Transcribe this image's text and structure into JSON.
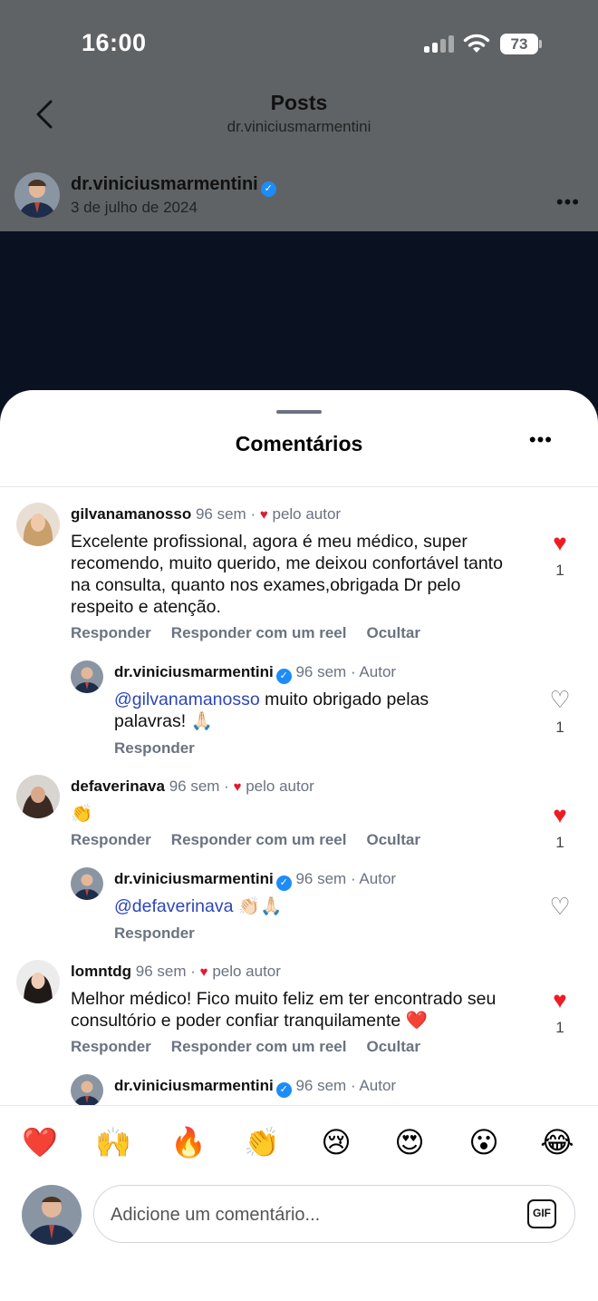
{
  "status_bar": {
    "time": "16:00",
    "battery": "73"
  },
  "header": {
    "title": "Posts",
    "subtitle": "dr.viniciusmarmentini"
  },
  "post": {
    "username": "dr.viniciusmarmentini",
    "date": "3 de julho de 2024",
    "more": "•••"
  },
  "sheet": {
    "title": "Comentários",
    "more": "•••"
  },
  "actions": {
    "reply": "Responder",
    "reply_reel": "Responder com um reel",
    "hide": "Ocultar"
  },
  "comments": [
    {
      "username": "gilvanamanosso",
      "time": "96 sem",
      "sep": "·",
      "badge": "pelo autor",
      "text": "Excelente profissional, agora é meu médico, super recomendo, muito querido, me deixou confortável tanto na consulta, quanto nos exames,obrigada Dr pelo respeito e atenção.",
      "likes": "1",
      "reply": {
        "username": "dr.viniciusmarmentini",
        "time": "96 sem",
        "sep": "·",
        "tag": "Autor",
        "mention": "@gilvanamanosso",
        "text": " muito obrigado pelas palavras! 🙏🏻",
        "likes": "1",
        "reply_label": "Responder"
      }
    },
    {
      "username": "defaverinava",
      "time": "96 sem",
      "sep": "·",
      "badge": "pelo autor",
      "text": "👏",
      "likes": "1",
      "reply": {
        "username": "dr.viniciusmarmentini",
        "time": "96 sem",
        "sep": "·",
        "tag": "Autor",
        "mention": "@defaverinava",
        "text": " 👏🏻🙏🏻",
        "likes": "",
        "reply_label": "Responder"
      }
    },
    {
      "username": "lomntdg",
      "time": "96 sem",
      "sep": "·",
      "badge": "pelo autor",
      "text": "Melhor médico! Fico muito feliz em ter encontrado seu consultório e poder confiar tranquilamente ❤️",
      "likes": "1",
      "reply": {
        "username": "dr.viniciusmarmentini",
        "time": "96 sem",
        "sep": "·",
        "tag": "Autor"
      }
    }
  ],
  "emoji_bar": [
    "❤️",
    "🙌",
    "🔥",
    "👏",
    "😢",
    "😍",
    "😮",
    "😂"
  ],
  "composer": {
    "placeholder": "Adicione um comentário...",
    "gif": "GIF"
  },
  "colors": {
    "like_red": "#ed1c24",
    "mention_blue": "#2d46b9",
    "verified_blue": "#1d8cf8"
  }
}
